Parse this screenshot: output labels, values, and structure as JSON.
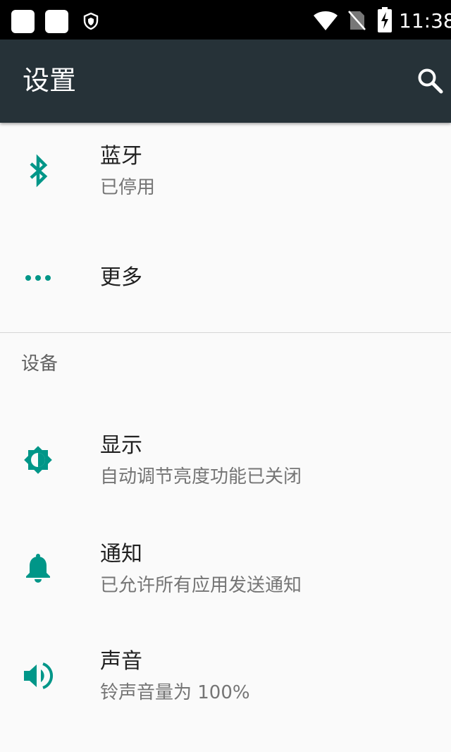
{
  "status_bar": {
    "time": "11:38",
    "icons": [
      "notification-square-icon",
      "notification-square-icon",
      "shield-icon",
      "wifi-icon",
      "no-sim-icon",
      "battery-charging-icon"
    ]
  },
  "app_bar": {
    "title": "设置",
    "search_icon": "search-icon",
    "background_color": "#263238"
  },
  "items": [
    {
      "title": "蓝牙",
      "subtitle": "已停用",
      "icon": "bluetooth-icon"
    },
    {
      "title": "更多",
      "icon": "more-horiz-icon"
    }
  ],
  "section": {
    "header": "设备",
    "items": [
      {
        "title": "显示",
        "subtitle": "自动调节亮度功能已关闭",
        "icon": "brightness-icon"
      },
      {
        "title": "通知",
        "subtitle": "已允许所有应用发送通知",
        "icon": "bell-icon"
      },
      {
        "title": "声音",
        "subtitle": "铃声音量为 100%",
        "icon": "volume-icon"
      }
    ]
  },
  "colors": {
    "accent": "#009688",
    "status_bar": "#000000",
    "background": "#fafafa"
  }
}
